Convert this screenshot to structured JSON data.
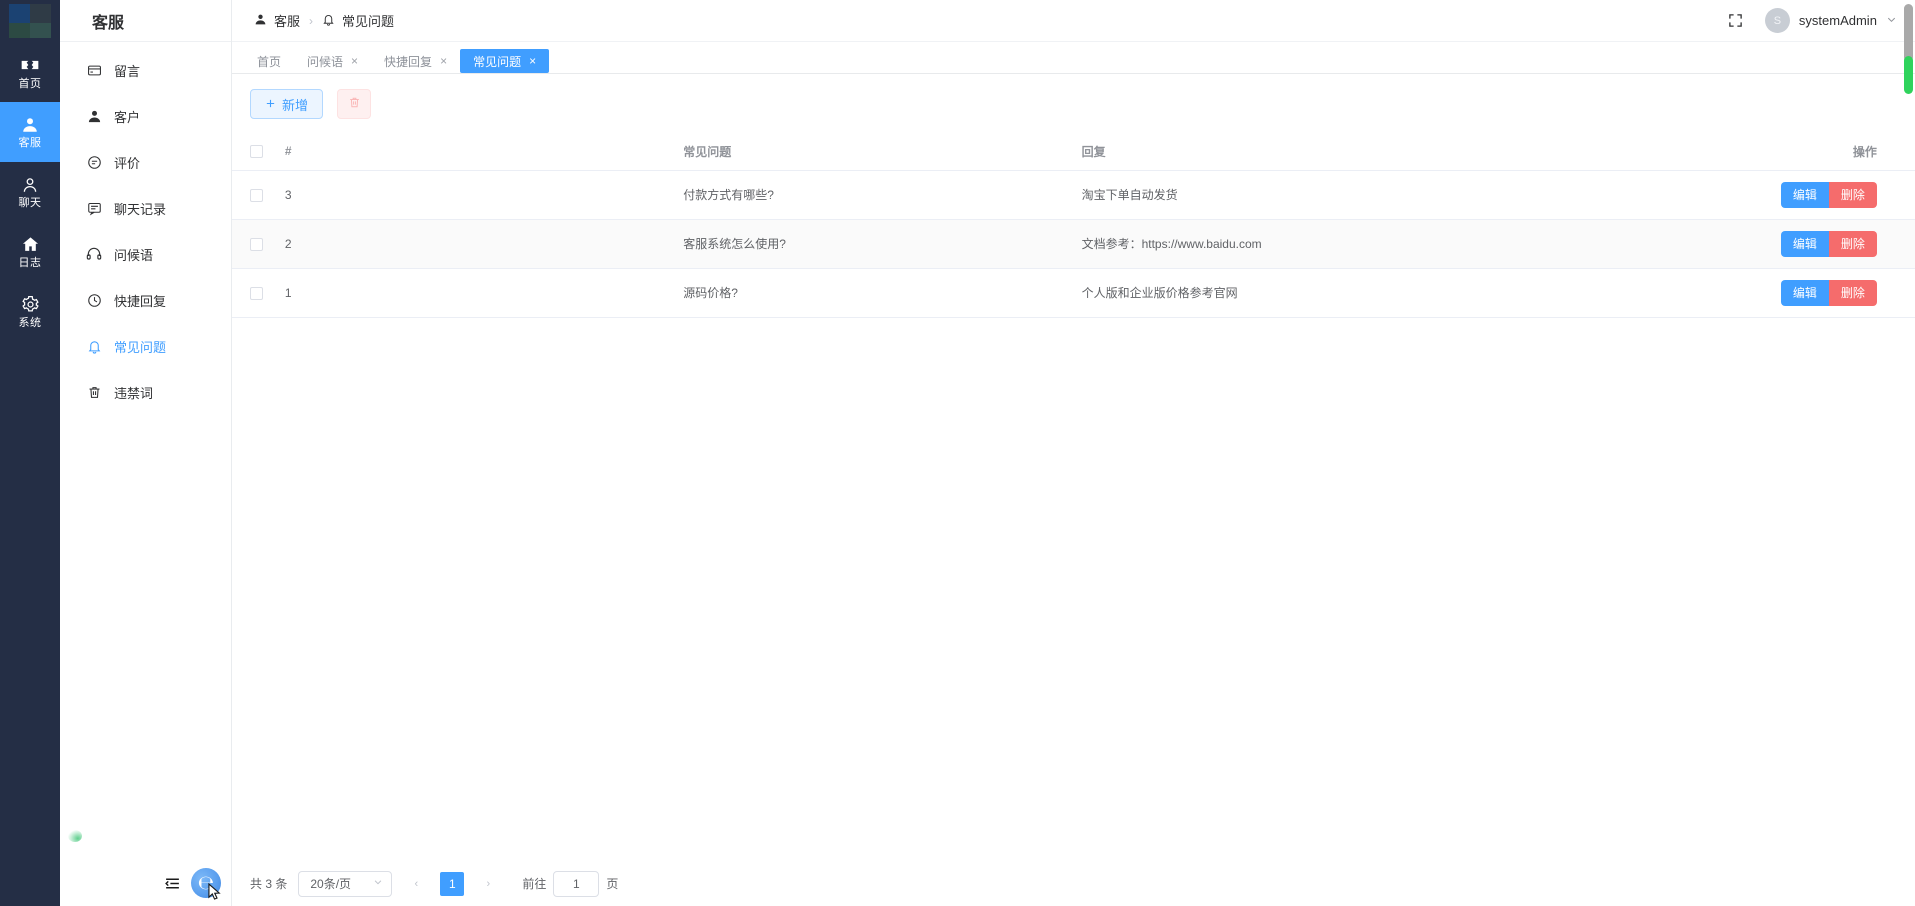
{
  "rail": {
    "logo_name": "app-logo",
    "items": [
      {
        "label": "首页",
        "icon": "ticket-icon",
        "active": false
      },
      {
        "label": "客服",
        "icon": "customer-service-icon",
        "active": true
      },
      {
        "label": "聊天",
        "icon": "user-outline-icon",
        "active": false
      },
      {
        "label": "日志",
        "icon": "home-icon",
        "active": false
      },
      {
        "label": "系统",
        "icon": "gear-icon",
        "active": false
      }
    ]
  },
  "submenu": {
    "title": "客服",
    "items": [
      {
        "label": "留言",
        "icon": "card-icon",
        "active": false
      },
      {
        "label": "客户",
        "icon": "user-solid-icon",
        "active": false
      },
      {
        "label": "评价",
        "icon": "comment-dots-icon",
        "active": false
      },
      {
        "label": "聊天记录",
        "icon": "chat-log-icon",
        "active": false
      },
      {
        "label": "问候语",
        "icon": "headset-icon",
        "active": false
      },
      {
        "label": "快捷回复",
        "icon": "clock-icon",
        "active": false
      },
      {
        "label": "常见问题",
        "icon": "bell-icon",
        "active": true
      },
      {
        "label": "违禁词",
        "icon": "trash-icon",
        "active": false
      }
    ],
    "footer": {
      "collapse_icon": "collapse-menu-icon",
      "browser_icon": "edge-browser-icon"
    }
  },
  "topbar": {
    "breadcrumb": [
      {
        "label": "客服",
        "icon": "user-solid-icon"
      },
      {
        "label": "常见问题",
        "icon": "bell-icon"
      }
    ],
    "separator": "›",
    "fullscreen_icon": "fullscreen-icon",
    "avatar_letter": "S",
    "user_name": "systemAdmin",
    "chevron": "⌄"
  },
  "tabs": [
    {
      "label": "首页",
      "closable": false,
      "active": false
    },
    {
      "label": "问候语",
      "closable": true,
      "active": false
    },
    {
      "label": "快捷回复",
      "closable": true,
      "active": false
    },
    {
      "label": "常见问题",
      "closable": true,
      "active": true
    }
  ],
  "tab_close_glyph": "×",
  "toolbar": {
    "add_label": "新增",
    "add_icon": "plus-icon",
    "delete_icon": "trash-icon"
  },
  "table": {
    "columns": [
      "#",
      "常见问题",
      "回复",
      "操作"
    ],
    "rows": [
      {
        "id": "3",
        "question": "付款方式有哪些?",
        "reply": "淘宝下单自动发货"
      },
      {
        "id": "2",
        "question": "客服系统怎么使用?",
        "reply": "文档参考：https://www.baidu.com"
      },
      {
        "id": "1",
        "question": "源码价格?",
        "reply": "个人版和企业版价格参考官网"
      }
    ],
    "edit_label": "编辑",
    "delete_label": "删除"
  },
  "pagination": {
    "total_text": "共 3 条",
    "page_size": "20条/页",
    "prev_glyph": "‹",
    "next_glyph": "›",
    "current_page": "1",
    "goto_label": "前往",
    "goto_value": "1",
    "page_unit": "页"
  },
  "colors": {
    "accent": "#409eff",
    "danger": "#f56c6c",
    "rail_bg": "#242e45",
    "scroll_green": "#2fd35c"
  }
}
